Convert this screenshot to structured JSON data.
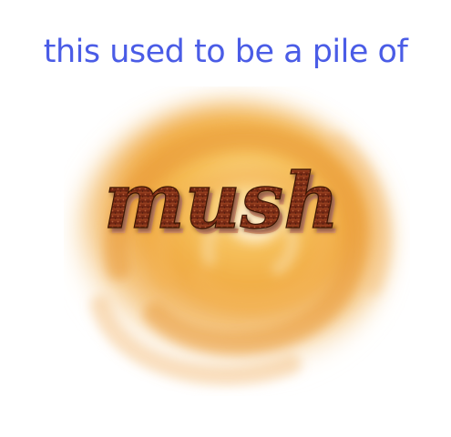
{
  "headline": {
    "text": "this used to be a pile of",
    "color": "#4a5ce6"
  },
  "artwork": {
    "word": "mush",
    "swirl_colors": {
      "core": "#f2b24a",
      "mid": "#f5c98a",
      "edge": "#fbe6c8"
    },
    "word_colors": {
      "fill": "#7a2e14",
      "highlight": "#e8a07a",
      "shadow": "#4a1a08"
    }
  }
}
